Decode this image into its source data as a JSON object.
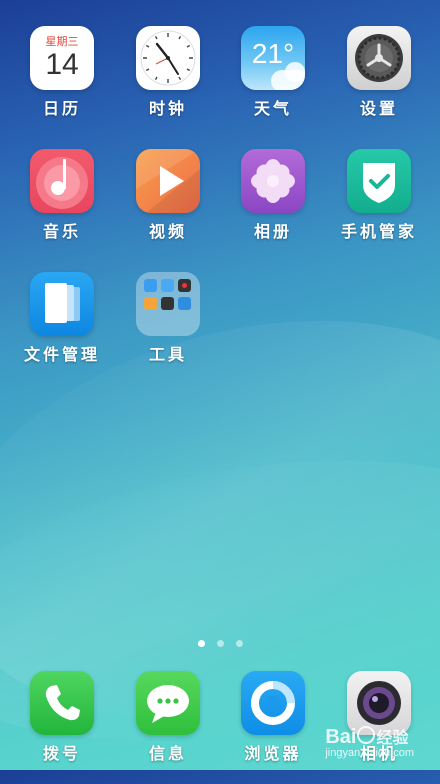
{
  "calendar": {
    "weekday": "星期三",
    "day": "14"
  },
  "weather": {
    "temperature": "21°"
  },
  "rows": [
    [
      {
        "id": "calendar",
        "label": "日历",
        "icon": "calendar-icon"
      },
      {
        "id": "clock",
        "label": "时钟",
        "icon": "clock-icon"
      },
      {
        "id": "weather",
        "label": "天气",
        "icon": "weather-icon"
      },
      {
        "id": "settings",
        "label": "设置",
        "icon": "gear-icon"
      }
    ],
    [
      {
        "id": "music",
        "label": "音乐",
        "icon": "music-note-icon"
      },
      {
        "id": "video",
        "label": "视频",
        "icon": "play-icon"
      },
      {
        "id": "photos",
        "label": "相册",
        "icon": "flower-icon"
      },
      {
        "id": "phone-manager",
        "label": "手机管家",
        "icon": "shield-check-icon"
      }
    ],
    [
      {
        "id": "file-manager",
        "label": "文件管理",
        "icon": "file-stack-icon"
      },
      {
        "id": "tools-folder",
        "label": "工具",
        "icon": "folder-icon"
      }
    ]
  ],
  "page_indicator": {
    "pages": 3,
    "current": 1
  },
  "dock": [
    {
      "id": "dialer",
      "label": "拨号",
      "icon": "phone-icon"
    },
    {
      "id": "messages",
      "label": "信息",
      "icon": "chat-bubble-icon"
    },
    {
      "id": "browser",
      "label": "浏览器",
      "icon": "browser-icon"
    },
    {
      "id": "camera",
      "label": "相机",
      "icon": "camera-icon"
    }
  ],
  "watermark": {
    "brand": "Bai",
    "brand_suffix": "经验",
    "url": "jingyan.baidu.com"
  }
}
